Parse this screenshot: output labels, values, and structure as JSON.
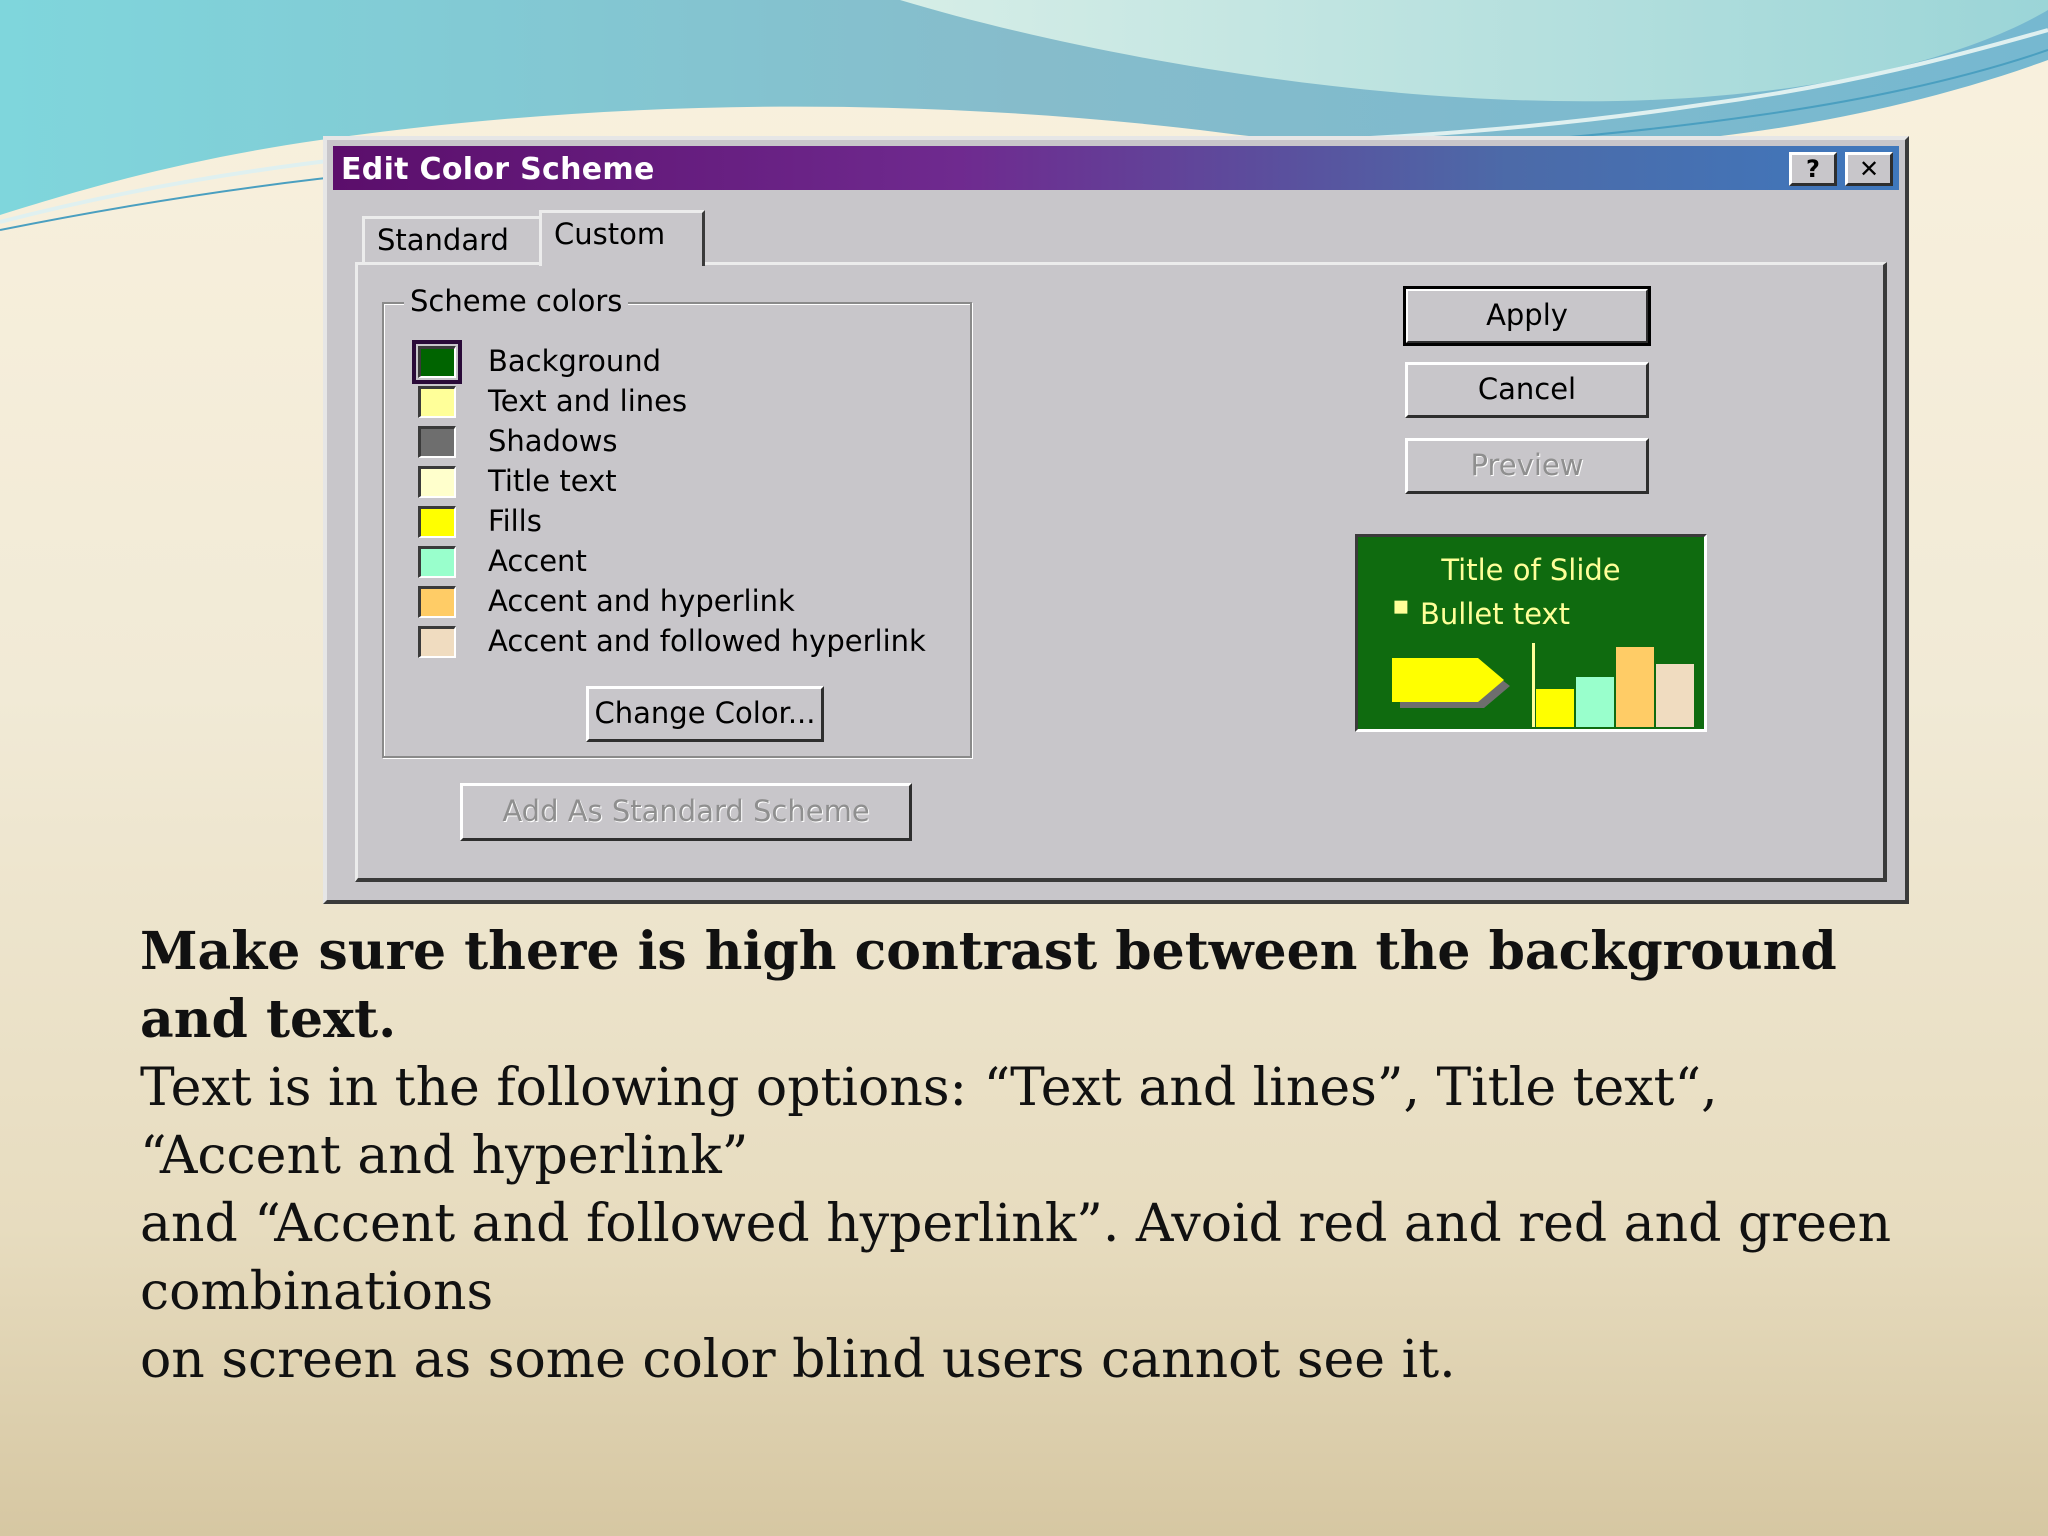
{
  "dialog": {
    "title": "Edit Color Scheme",
    "help_label": "?",
    "close_label": "✕",
    "tabs": [
      {
        "label": "Standard",
        "active": false
      },
      {
        "label": "Custom",
        "active": true
      }
    ],
    "scheme_group_label": "Scheme colors",
    "scheme_items": [
      {
        "label": "Background",
        "color": "#006400",
        "selected": true
      },
      {
        "label": "Text and lines",
        "color": "#ffff99",
        "selected": false
      },
      {
        "label": "Shadows",
        "color": "#6e6e6e",
        "selected": false
      },
      {
        "label": "Title text",
        "color": "#ffffcc",
        "selected": false
      },
      {
        "label": "Fills",
        "color": "#ffff00",
        "selected": false
      },
      {
        "label": "Accent",
        "color": "#99ffcc",
        "selected": false
      },
      {
        "label": "Accent and hyperlink",
        "color": "#ffcc66",
        "selected": false
      },
      {
        "label": "Accent and followed hyperlink",
        "color": "#f0dcc0",
        "selected": false
      }
    ],
    "change_color_label": "Change Color...",
    "add_standard_label": "Add As Standard Scheme",
    "apply_label": "Apply",
    "cancel_label": "Cancel",
    "preview_label": "Preview",
    "preview_sample": {
      "title": "Title of Slide",
      "bullet_marker": "▪",
      "bullet": "Bullet text",
      "bar_colors": [
        "#ffff00",
        "#99ffcc",
        "#ffcc66",
        "#f0dcc0"
      ]
    }
  },
  "caption": {
    "bold_line": "Make sure there is high contrast between the background and text.",
    "lines": [
      "Text is in the following options: “Text and lines”, Title text“, “Accent and hyperlink”",
      "and “Accent and followed hyperlink”. Avoid red and red and green combinations",
      "on screen as some color blind users cannot see it."
    ]
  }
}
